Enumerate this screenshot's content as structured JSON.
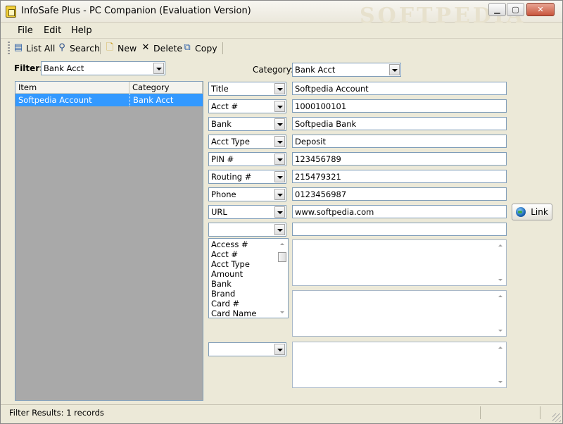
{
  "window": {
    "title": "InfoSafe Plus - PC Companion (Evaluation Version)",
    "controls": {
      "minimize": "▁",
      "maximize": "▢",
      "close": "✕"
    },
    "watermark": "SOFTPEDIA"
  },
  "menu": {
    "items": [
      "File",
      "Edit",
      "Help"
    ]
  },
  "toolbar": {
    "list_all": "List All",
    "search": "Search",
    "new": "New",
    "delete": "Delete",
    "copy": "Copy",
    "icons": {
      "list_all": "list-all-icon",
      "search": "binoculars-icon",
      "new": "new-document-icon",
      "delete": "delete-x-icon",
      "copy": "copy-icon"
    }
  },
  "filter": {
    "label": "Filter:",
    "value": "Bank Acct"
  },
  "item_list": {
    "columns": [
      "Item",
      "Category"
    ],
    "rows": [
      {
        "item": "Softpedia Account",
        "category": "Bank Acct"
      }
    ]
  },
  "category": {
    "label": "Category:",
    "value": "Bank Acct"
  },
  "fields": [
    {
      "name": "Title",
      "value": "Softpedia Account"
    },
    {
      "name": "Acct #",
      "value": "1000100101"
    },
    {
      "name": "Bank",
      "value": "Softpedia Bank"
    },
    {
      "name": "Acct Type",
      "value": "Deposit"
    },
    {
      "name": "PIN #",
      "value": "123456789"
    },
    {
      "name": "Routing #",
      "value": "215479321"
    },
    {
      "name": "Phone",
      "value": "0123456987"
    },
    {
      "name": "URL",
      "value": "www.softpedia.com"
    },
    {
      "name": "",
      "value": ""
    }
  ],
  "link_button": "Link",
  "field_name_options": [
    "Access #",
    "Acct #",
    "Acct Type",
    "Amount",
    "Bank",
    "Brand",
    "Card #",
    "Card Name"
  ],
  "notes_selector": {
    "value": ""
  },
  "status": {
    "text": "Filter Results: 1 records"
  },
  "colors": {
    "selection": "#3399ff",
    "list_background": "#a9a9a9",
    "window": "#ece9d8"
  }
}
